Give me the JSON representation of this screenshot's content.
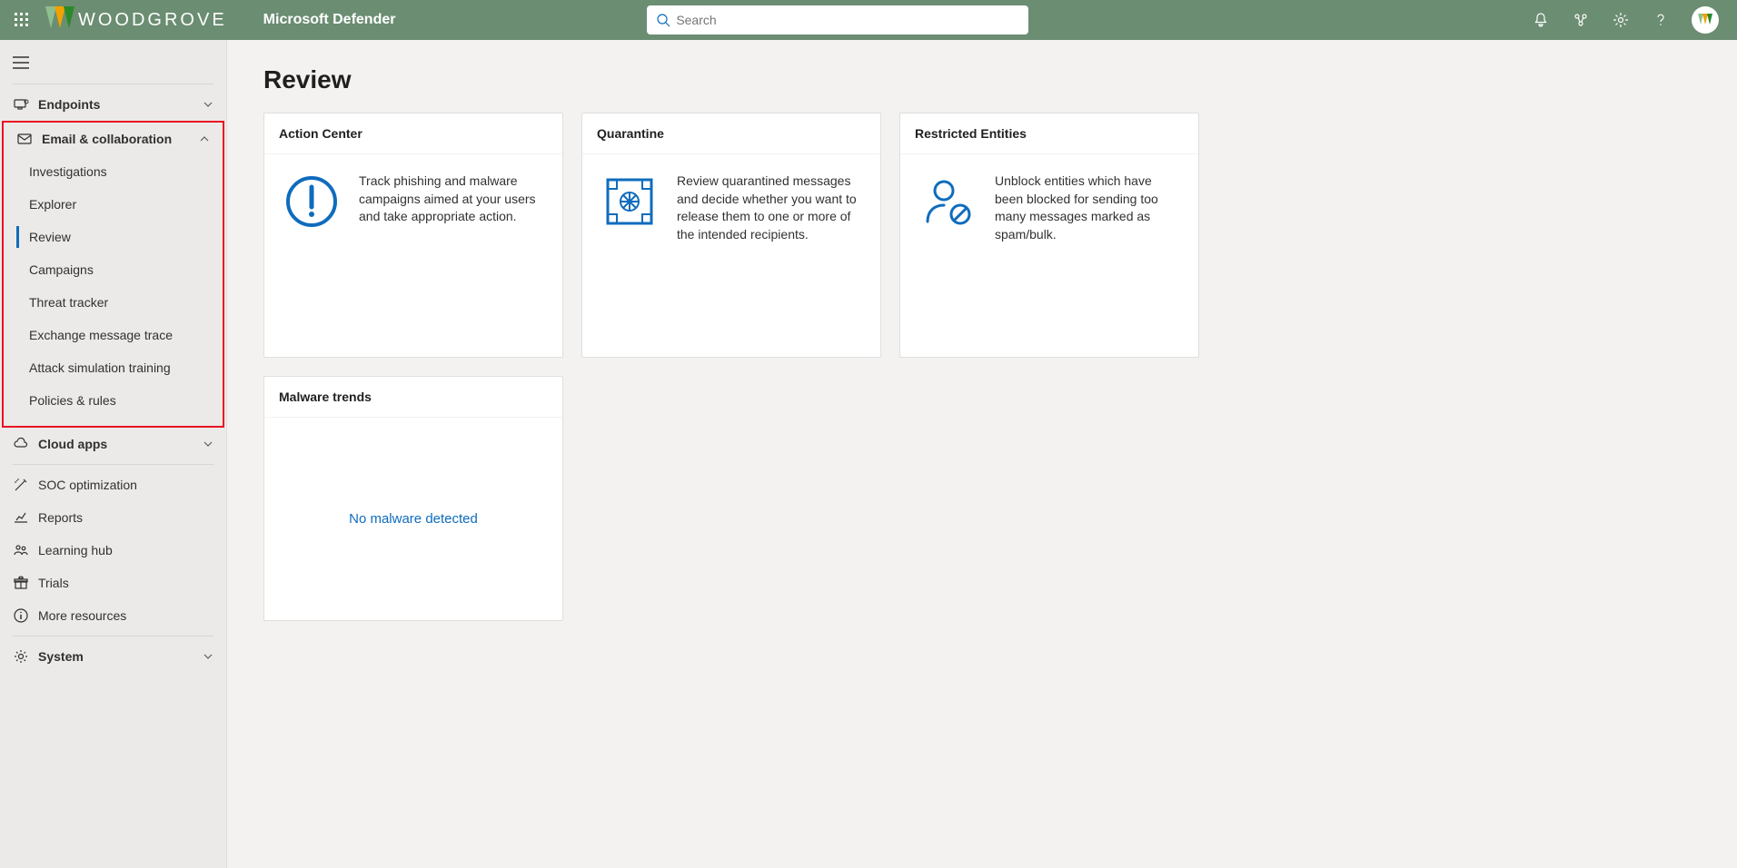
{
  "header": {
    "brand_name": "WOODGROVE",
    "app_title": "Microsoft Defender",
    "search_placeholder": "Search"
  },
  "sidebar": {
    "endpoints": "Endpoints",
    "email_collab": "Email & collaboration",
    "sub_items": {
      "investigations": "Investigations",
      "explorer": "Explorer",
      "review": "Review",
      "campaigns": "Campaigns",
      "threat_tracker": "Threat tracker",
      "exchange_trace": "Exchange message trace",
      "attack_sim": "Attack simulation training",
      "policies_rules": "Policies & rules"
    },
    "cloud_apps": "Cloud apps",
    "soc_opt": "SOC optimization",
    "reports": "Reports",
    "learning": "Learning hub",
    "trials": "Trials",
    "more_resources": "More resources",
    "system": "System"
  },
  "main": {
    "page_title": "Review",
    "cards": {
      "action_center": {
        "title": "Action Center",
        "body": "Track phishing and malware campaigns aimed at your users and take appropriate action."
      },
      "quarantine": {
        "title": "Quarantine",
        "body": "Review quarantined messages and decide whether you want to release them to one or more of the intended recipients."
      },
      "restricted": {
        "title": "Restricted Entities",
        "body": "Unblock entities which have been blocked for sending too many messages marked as spam/bulk."
      },
      "malware_trends": {
        "title": "Malware trends",
        "message": "No malware detected"
      }
    }
  }
}
